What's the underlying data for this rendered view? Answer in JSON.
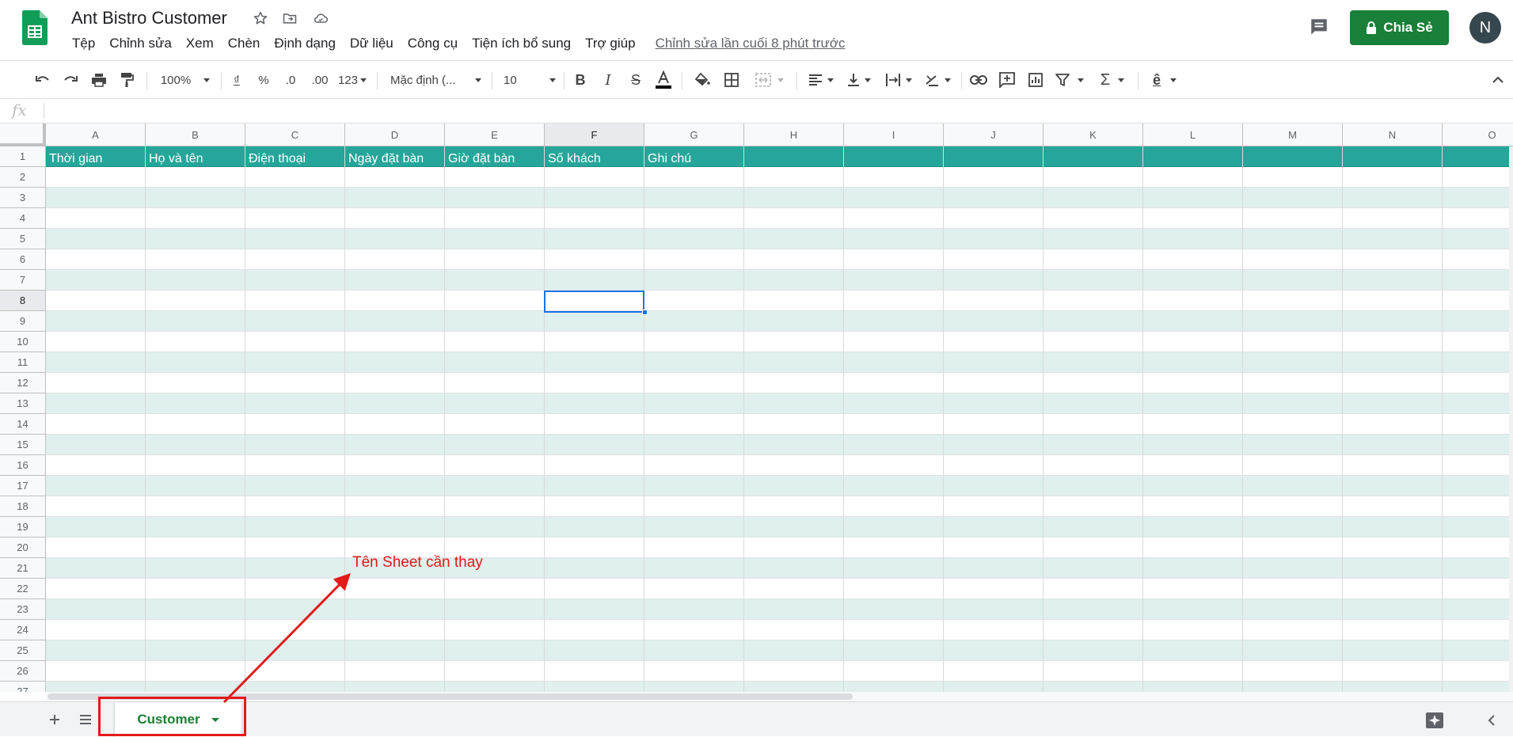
{
  "app": {
    "title": "Ant Bistro Customer",
    "last_edit": "Chỉnh sửa lần cuối 8 phút trước",
    "share_label": "Chia Sẻ",
    "avatar_initial": "N",
    "brand_color": "#188038"
  },
  "menu": [
    "Tệp",
    "Chỉnh sửa",
    "Xem",
    "Chèn",
    "Định dạng",
    "Dữ liệu",
    "Công cụ",
    "Tiện ích bổ sung",
    "Trợ giúp"
  ],
  "toolbar": {
    "zoom": "100%",
    "currency": "₫",
    "percent": "%",
    "decimal_decrease": ".0",
    "decimal_increase": ".00",
    "more_formats": "123",
    "font": "Mặc định (...",
    "font_size": "10"
  },
  "formula_bar": {
    "fx_label": "fx",
    "value": ""
  },
  "grid": {
    "columns": [
      "A",
      "B",
      "C",
      "D",
      "E",
      "F",
      "G",
      "H",
      "I",
      "J",
      "K",
      "L",
      "M",
      "N",
      "O"
    ],
    "selected_column": "F",
    "selected_row": "8",
    "rows": [
      "1",
      "2",
      "3",
      "4",
      "5",
      "6",
      "7",
      "8",
      "9",
      "10",
      "11",
      "12",
      "13",
      "14",
      "15",
      "16",
      "17",
      "18",
      "19",
      "20",
      "21",
      "22",
      "23",
      "24",
      "25",
      "26",
      "27"
    ],
    "header_row": [
      "Thời gian",
      "Họ và tên",
      "Điện thoại",
      "Ngày đặt bàn",
      "Giờ đặt bàn",
      "Số khách",
      "Ghi chú"
    ],
    "header_color": "#26a69a",
    "band_color": "#dff0ee"
  },
  "sheets": {
    "tabs": [
      {
        "name": "Customer",
        "active": true
      }
    ]
  },
  "annotation": {
    "text": "Tên Sheet cần thay",
    "color": "#e21a1a"
  }
}
